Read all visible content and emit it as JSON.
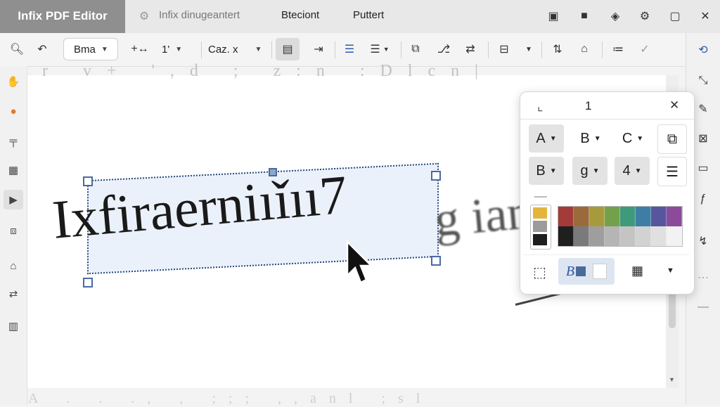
{
  "titlebar": {
    "app_title": "Infix PDF Editor",
    "tabs": [
      "Infix dinugeantert",
      "Bteciont",
      "Puttert"
    ]
  },
  "toolbar": {
    "font_name": "Bma",
    "font_size": "1'",
    "style_dropdown": "Caz. x"
  },
  "popup": {
    "title": "1",
    "row1": [
      "A",
      "B",
      "C"
    ],
    "row2": [
      "B",
      "g",
      "4"
    ],
    "swatches": [
      "#e3b53a",
      "#9b9b9b",
      "#1e1e1e"
    ],
    "palette_top": [
      "#a33b3b",
      "#9b6a3a",
      "#a79a3c",
      "#73a04a",
      "#3f9a7c",
      "#3e7ea4",
      "#58559f",
      "#8c4a9a"
    ],
    "palette_bottom": [
      "#1f1f1f",
      "#7a7a7a",
      "#9e9e9e",
      "#b5b5b5",
      "#c4c4c4",
      "#d2d2d2",
      "#e0e0e0",
      "#f2f2f2"
    ],
    "bottom_mode": "B"
  },
  "document": {
    "selected_text": "Ixfiraerniıǐıı7",
    "following_text": "g ian",
    "faded_top": "r v+ ',d ; z:n :Dlcn|",
    "faded_bottom": "A  . . ., , ;;; ,,anl ;sl"
  }
}
